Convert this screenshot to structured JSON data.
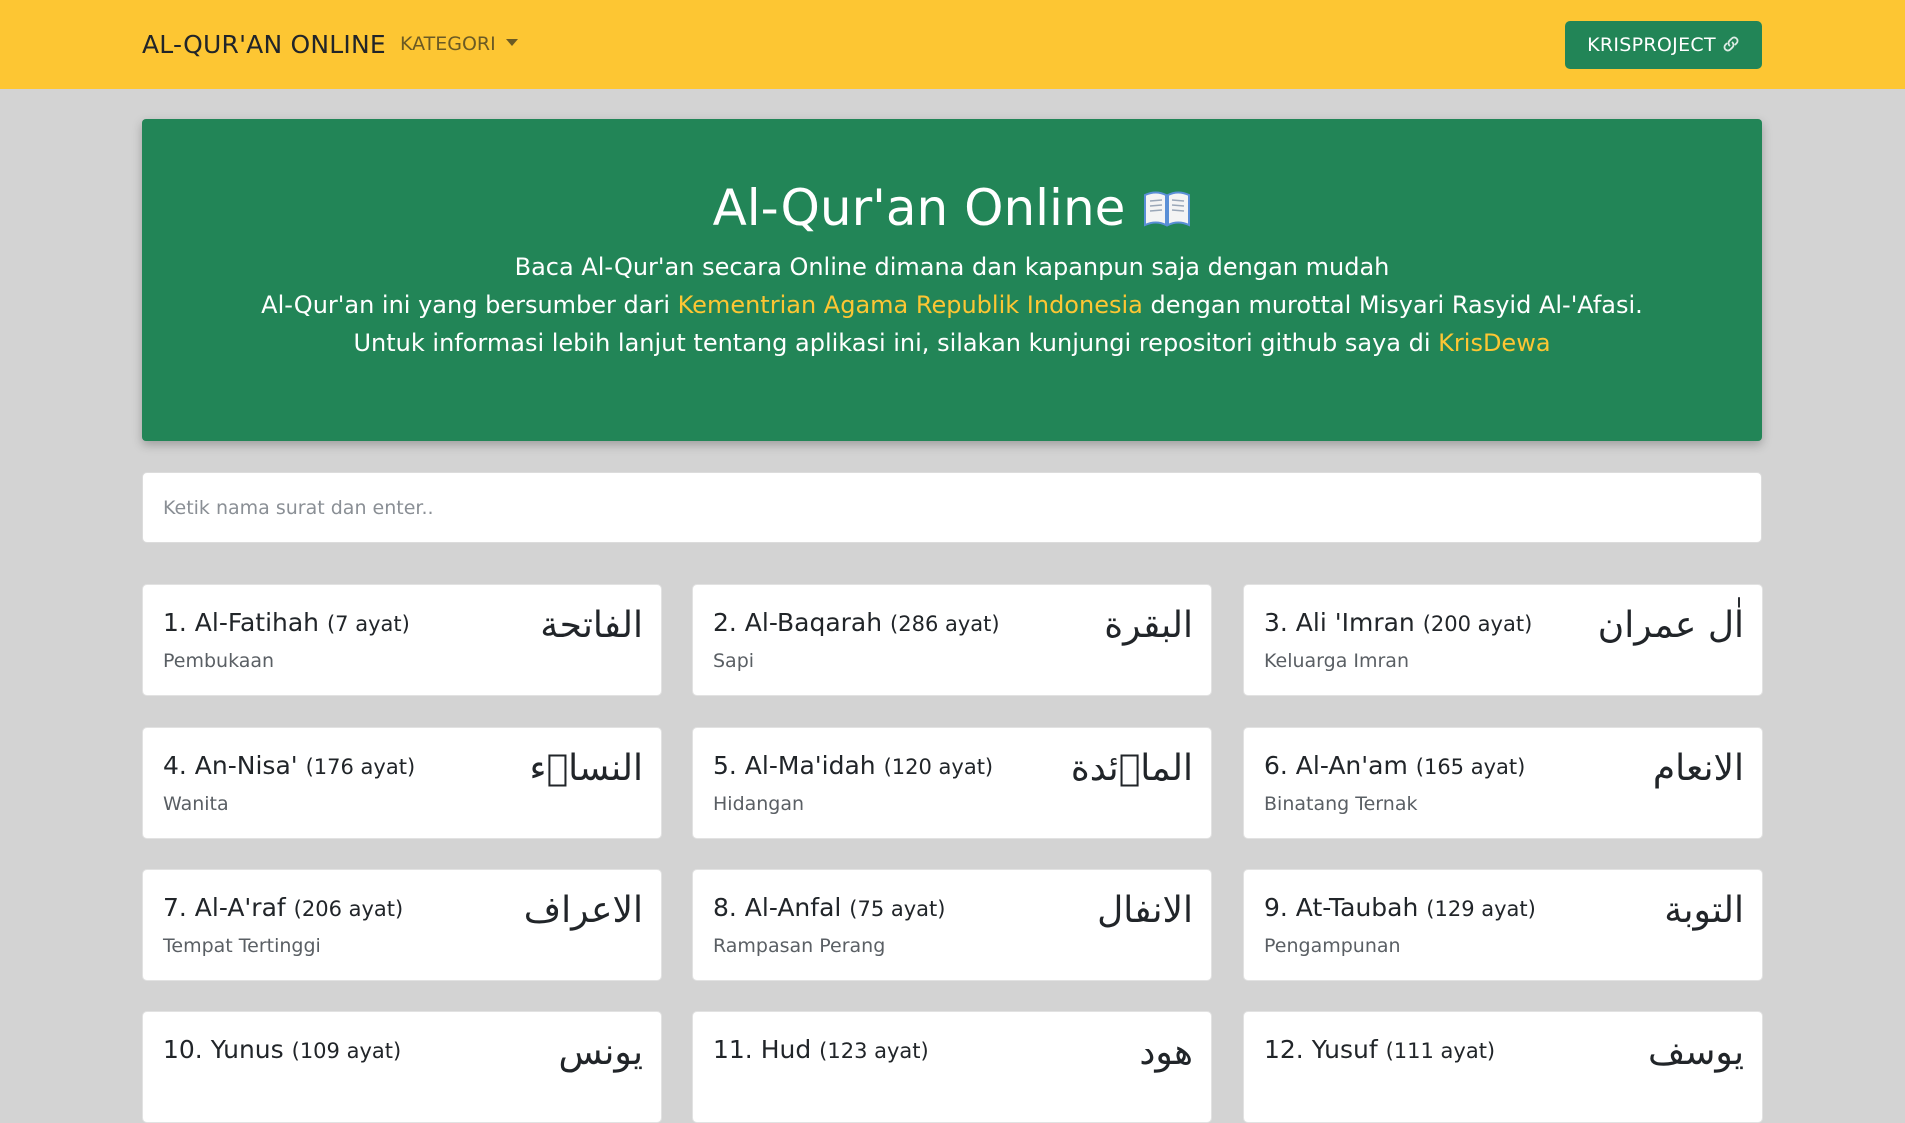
{
  "navbar": {
    "brand": "AL-QUR'AN ONLINE",
    "kategori": "KATEGORI",
    "project_button": "KRISPROJECT",
    "project_icon": "link-icon",
    "background_color": "#fdc633",
    "button_color": "#228557"
  },
  "hero": {
    "title": "Al-Qur'an Online",
    "title_icon": "open-book-icon",
    "line1": "Baca Al-Qur'an secara Online dimana dan kapanpun saja dengan mudah",
    "line2_prefix": "Al-Qur'an ini yang bersumber dari ",
    "line2_link": "Kementrian Agama Republik Indonesia",
    "line2_suffix": " dengan murottal Misyari Rasyid Al-'Afasi.",
    "line3_prefix": "Untuk informasi lebih lanjut tentang aplikasi ini, silakan kunjungi repositori github saya di ",
    "line3_link": "KrisDewa",
    "background_color": "#228557",
    "link_color": "#fdc633"
  },
  "search": {
    "placeholder": "Ketik nama surat dan enter..",
    "value": ""
  },
  "surahs": [
    {
      "title": "1. Al-Fatihah",
      "ayat": "(7 ayat)",
      "meaning": "Pembukaan",
      "arabic": "الفاتحة"
    },
    {
      "title": "2. Al-Baqarah",
      "ayat": "(286 ayat)",
      "meaning": "Sapi",
      "arabic": "البقرة"
    },
    {
      "title": "3. Ali 'Imran",
      "ayat": "(200 ayat)",
      "meaning": "Keluarga Imran",
      "arabic": "اٰل عمران"
    },
    {
      "title": "4. An-Nisa'",
      "ayat": "(176 ayat)",
      "meaning": "Wanita",
      "arabic": "النساۤء"
    },
    {
      "title": "5. Al-Ma'idah",
      "ayat": "(120 ayat)",
      "meaning": "Hidangan",
      "arabic": "الماۤئدة"
    },
    {
      "title": "6. Al-An'am",
      "ayat": "(165 ayat)",
      "meaning": "Binatang Ternak",
      "arabic": "الانعام"
    },
    {
      "title": "7. Al-A'raf",
      "ayat": "(206 ayat)",
      "meaning": "Tempat Tertinggi",
      "arabic": "الاعراف"
    },
    {
      "title": "8. Al-Anfal",
      "ayat": "(75 ayat)",
      "meaning": "Rampasan Perang",
      "arabic": "الانفال"
    },
    {
      "title": "9. At-Taubah",
      "ayat": "(129 ayat)",
      "meaning": "Pengampunan",
      "arabic": "التوبة"
    },
    {
      "title": "10. Yunus",
      "ayat": "(109 ayat)",
      "meaning": "",
      "arabic": "يونس"
    },
    {
      "title": "11. Hud",
      "ayat": "(123 ayat)",
      "meaning": "",
      "arabic": "هود"
    },
    {
      "title": "12. Yusuf",
      "ayat": "(111 ayat)",
      "meaning": "",
      "arabic": "يوسف"
    }
  ]
}
